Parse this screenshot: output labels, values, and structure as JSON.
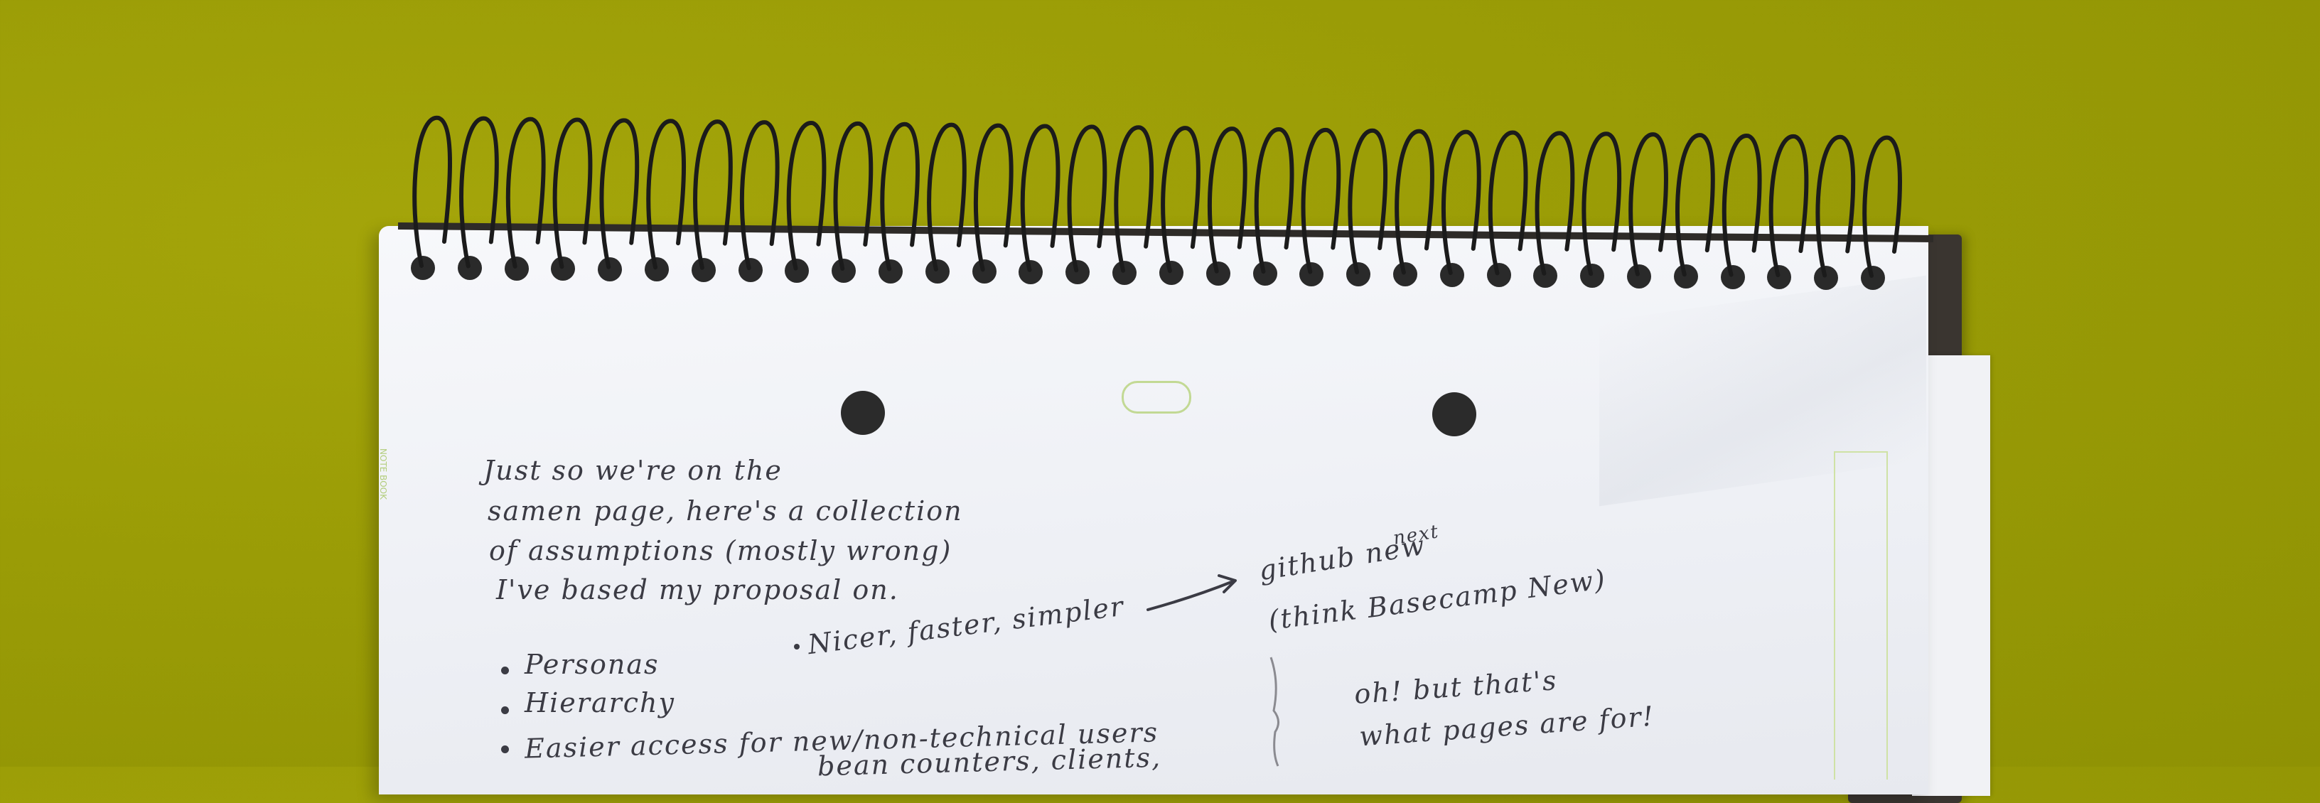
{
  "scene": {
    "description_colors": {
      "background": "#9a9c06",
      "paper": "#f3f4f8",
      "ink": "#3b3b44",
      "spiral": "#1b1b1b"
    }
  },
  "notebook": {
    "side_brand": "NOTE BOOK",
    "spiral_icon": "spiral-binding-icon"
  },
  "notes": {
    "line1": "Just so we're on the",
    "line2": "samen page, here's a collection",
    "line3": "of assumptions (mostly wrong)",
    "line4": "I've based my proposal on.",
    "bullet1": "Personas",
    "bullet2": "Hierarchy",
    "bullet3": "Easier access for new/non-technical users",
    "bullet3b": "bean counters, clients,",
    "mid": "Nicer, faster, simpler",
    "github_line": "github new",
    "github_insert": "next",
    "think_line": "(think Basecamp New)",
    "oh_line": "oh! but that's",
    "pages_line": "what pages are for!"
  }
}
